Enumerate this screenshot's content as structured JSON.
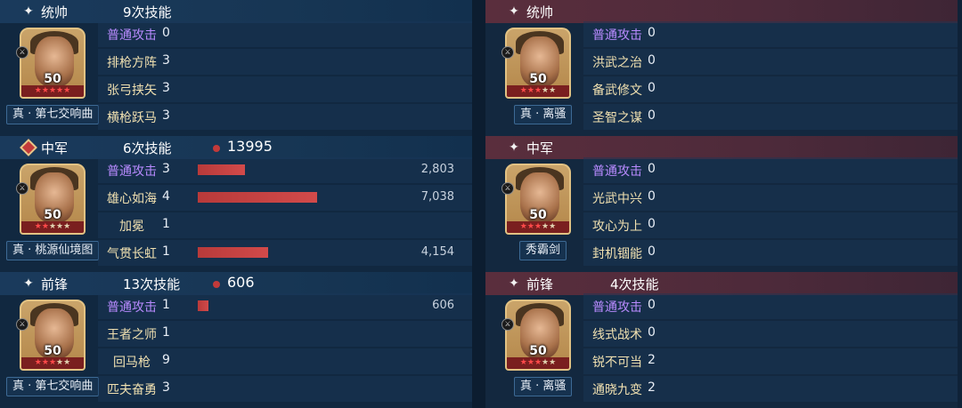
{
  "left": {
    "sections": [
      {
        "role": "统帅",
        "count": "9次技能",
        "total": null,
        "gear": "真 · 第七交响曲",
        "level": "50",
        "stars_full": 5,
        "stars_total": 5,
        "skills": [
          {
            "name": "普通攻击",
            "count": "0",
            "basic": true
          },
          {
            "name": "排枪方阵",
            "count": "3"
          },
          {
            "name": "张弓挟矢",
            "count": "3"
          },
          {
            "name": "横枪跃马",
            "count": "3"
          }
        ]
      },
      {
        "role": "中军",
        "count": "6次技能",
        "total": "13995",
        "gear": "真 · 桃源仙境图",
        "level": "50",
        "stars_full": 2,
        "stars_total": 5,
        "skills": [
          {
            "name": "普通攻击",
            "count": "3",
            "basic": true,
            "damage": "2,803",
            "damage_value": 2803
          },
          {
            "name": "雄心如海",
            "count": "4",
            "damage": "7,038",
            "damage_value": 7038
          },
          {
            "name": "加冕",
            "count": "1"
          },
          {
            "name": "气贯长虹",
            "count": "1",
            "damage": "4,154",
            "damage_value": 4154
          }
        ]
      },
      {
        "role": "前锋",
        "count": "13次技能",
        "total": "606",
        "gear": "真 · 第七交响曲",
        "level": "50",
        "stars_full": 3,
        "stars_total": 5,
        "skills": [
          {
            "name": "普通攻击",
            "count": "1",
            "basic": true,
            "damage": "606",
            "damage_value": 606
          },
          {
            "name": "王者之师",
            "count": "1"
          },
          {
            "name": "回马枪",
            "count": "9"
          },
          {
            "name": "匹夫奋勇",
            "count": "3"
          }
        ]
      }
    ]
  },
  "right": {
    "sections": [
      {
        "role": "统帅",
        "count": "",
        "gear": "真 · 离骚",
        "level": "50",
        "stars_full": 3,
        "stars_total": 5,
        "skills": [
          {
            "name": "普通攻击",
            "count": "0",
            "basic": true
          },
          {
            "name": "洪武之治",
            "count": "0"
          },
          {
            "name": "备武修文",
            "count": "0"
          },
          {
            "name": "圣智之谋",
            "count": "0"
          }
        ]
      },
      {
        "role": "中军",
        "count": "",
        "gear": "秀霸剑",
        "level": "50",
        "stars_full": 3,
        "stars_total": 5,
        "skills": [
          {
            "name": "普通攻击",
            "count": "0",
            "basic": true
          },
          {
            "name": "光武中兴",
            "count": "0"
          },
          {
            "name": "攻心为上",
            "count": "0"
          },
          {
            "name": "封机锢能",
            "count": "0"
          }
        ]
      },
      {
        "role": "前锋",
        "count": "4次技能",
        "gear": "真 · 离骚",
        "level": "50",
        "stars_full": 3,
        "stars_total": 5,
        "skills": [
          {
            "name": "普通攻击",
            "count": "0",
            "basic": true
          },
          {
            "name": "线式战术",
            "count": "0"
          },
          {
            "name": "锐不可当",
            "count": "2"
          },
          {
            "name": "通晓九变",
            "count": "2"
          }
        ]
      }
    ]
  },
  "icons": {
    "role": "sparkle-icon",
    "zhongjun_left": "diamond-emblem-icon",
    "damage_dot": "red-dot-icon"
  },
  "colors": {
    "basic_skill": "#b98bff",
    "skill": "#f0e0b0",
    "bar": "#c23a3a",
    "left_header": "#1a3a5c",
    "right_header": "#5a2e3d"
  },
  "max_damage": 7038
}
